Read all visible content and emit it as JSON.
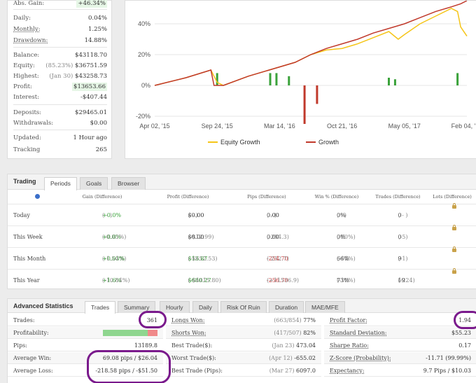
{
  "stats": {
    "abs_gain": {
      "label": "Abs. Gain:",
      "value": "+46.34%"
    },
    "daily": {
      "label": "Daily:",
      "value": "0.04%"
    },
    "monthly": {
      "label": "Monthly:",
      "value": "1.25%"
    },
    "drawdown": {
      "label": "Drawdown:",
      "value": "14.88%"
    },
    "balance": {
      "label": "Balance:",
      "value": "$43118.70"
    },
    "equity": {
      "label": "Equity:",
      "note": "(85.23%)",
      "value": "$36751.59"
    },
    "highest": {
      "label": "Highest:",
      "note": "(Jan 30)",
      "value": "$43258.73"
    },
    "profit": {
      "label": "Profit:",
      "value": "$13653.66"
    },
    "interest": {
      "label": "Interest:",
      "value": "-$407.44"
    },
    "deposits": {
      "label": "Deposits:",
      "value": "$29465.01"
    },
    "withdrawals": {
      "label": "Withdrawals:",
      "value": "$0.00"
    },
    "updated": {
      "label": "Updated:",
      "value": "1 Hour ago"
    },
    "tracking": {
      "label": "Tracking",
      "value": "265"
    }
  },
  "chart_data": {
    "type": "line",
    "x_ticks": [
      "Apr 02, '15",
      "Sep 24, '15",
      "Mar 14, '16",
      "Oct 21, '16",
      "May 05, '17",
      "Feb 04, '18"
    ],
    "y_ticks": [
      "40%",
      "20%",
      "0%",
      "-20%"
    ],
    "ylim": [
      -20,
      55
    ],
    "grid": true,
    "legend_position": "bottom",
    "series": [
      {
        "name": "Equity Growth",
        "color": "#f5c518",
        "x": [
          0,
          0.1,
          0.18,
          0.2,
          0.22,
          0.3,
          0.4,
          0.45,
          0.5,
          0.55,
          0.6,
          0.65,
          0.7,
          0.75,
          0.78,
          0.8,
          0.85,
          0.9,
          0.95,
          0.97,
          0.98,
          1.0
        ],
        "values": [
          0,
          5,
          10,
          2,
          0,
          6,
          12,
          15,
          20,
          23,
          24,
          27,
          31,
          35,
          30,
          33,
          40,
          45,
          50,
          48,
          38,
          32
        ]
      },
      {
        "name": "Growth",
        "color": "#c0392b",
        "x": [
          0,
          0.1,
          0.18,
          0.19,
          0.22,
          0.3,
          0.4,
          0.45,
          0.5,
          0.55,
          0.6,
          0.65,
          0.7,
          0.75,
          0.8,
          0.85,
          0.9,
          0.95,
          0.98,
          1.0
        ],
        "values": [
          0,
          5,
          10,
          0,
          0,
          6,
          12,
          15,
          20,
          24,
          27,
          30,
          34,
          37,
          40,
          44,
          48,
          51,
          53,
          55
        ]
      }
    ],
    "bars": {
      "color_pos": "#3aa23a",
      "color_neg": "#c0392b",
      "x": [
        0.2,
        0.37,
        0.39,
        0.43,
        0.75,
        0.77,
        0.97,
        0.48,
        0.52
      ],
      "values": [
        8,
        8,
        8,
        6,
        5,
        4,
        8,
        -25,
        -12
      ]
    }
  },
  "trading": {
    "title": "Trading",
    "tabs": [
      "Periods",
      "Goals",
      "Browser"
    ],
    "headers": [
      "Gain (Difference)",
      "Profit (Difference)",
      "Pips (Difference)",
      "Win % (Difference)",
      "Trades (Difference)",
      "Lots (Difference)"
    ],
    "rows": [
      {
        "label": "Today",
        "gain": "+0.0%",
        "gain_diff": "( - )",
        "profit": "$0.00",
        "profit_diff": "( - )",
        "pips": "0.00",
        "pips_diff": "( - )",
        "win": "0%",
        "win_diff": "( - )",
        "trades": "0",
        "trades_diff": "( - )"
      },
      {
        "label": "This Week",
        "gain": "+0.0%",
        "gain_diff": "(-0.03%)",
        "profit": "$0.00",
        "profit_diff": "(-$12.99)",
        "pips": "0.00",
        "pips_diff": "(-284.3)",
        "win": "0%",
        "win_diff": "(-60%)",
        "trades": "0",
        "trades_diff": "(-5)"
      },
      {
        "label": "This Month",
        "gain": "+0.03%",
        "gain_diff": "(-1.54%)",
        "profit": "$13.87",
        "profit_diff": "(-$652.53)",
        "pips": "-254.70",
        "pips_diff": "(-252.7)",
        "win": "66%",
        "win_diff": "(-14%)",
        "trades": "9",
        "trades_diff": "(-1)"
      },
      {
        "label": "This Year",
        "gain": "+1.6%",
        "gain_diff": "(-10.84%)",
        "profit": "$680.27",
        "profit_diff": "(-$4015.80)",
        "pips": "-256.70",
        "pips_diff": "(+11536.9)",
        "win": "73%",
        "win_diff": "(-10%)",
        "trades": "19",
        "trades_diff": "(-224)"
      }
    ]
  },
  "advanced": {
    "title": "Advanced Statistics",
    "tabs": [
      "Trades",
      "Summary",
      "Hourly",
      "Daily",
      "Risk Of Ruin",
      "Duration",
      "MAE/MFE"
    ],
    "col1": [
      {
        "label": "Trades:",
        "value": "361"
      },
      {
        "label": "Profitability:",
        "value": "",
        "win_fraction": 0.82
      },
      {
        "label": "Pips:",
        "value": "13189.8"
      },
      {
        "label": "Average Win:",
        "value": "69.08 pips / $26.04"
      },
      {
        "label": "Average Loss:",
        "value": "-218.58 pips / -$51.50"
      }
    ],
    "col2": [
      {
        "label": "Longs Won:",
        "note": "(663/854)",
        "value": "77%"
      },
      {
        "label": "Shorts Won:",
        "note": "(417/507)",
        "value": "82%"
      },
      {
        "label": "Best Trade($):",
        "note": "(Jan 23)",
        "value": "473.04"
      },
      {
        "label": "Worst Trade($):",
        "note": "(Apr 12)",
        "value": "-655.02"
      },
      {
        "label": "Best Trade (Pips):",
        "note": "(Mar 27)",
        "value": "6097.0"
      }
    ],
    "col3": [
      {
        "label": "Profit Factor:",
        "value": "1.94"
      },
      {
        "label": "Standard Deviation:",
        "value": "$55.23"
      },
      {
        "label": "Sharpe Ratio:",
        "value": "0.17"
      },
      {
        "label": "Z-Score (Probability):",
        "value": "-11.71 (99.99%)"
      },
      {
        "label": "Expectancy:",
        "value": "9.7 Pips / $10.03"
      }
    ]
  }
}
